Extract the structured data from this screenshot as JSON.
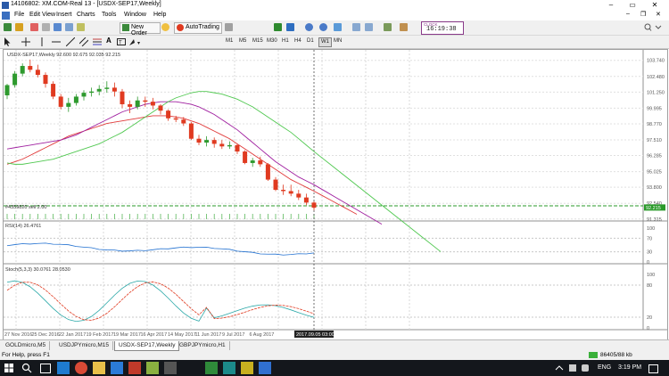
{
  "window": {
    "title": "14106802: XM.COM-Real 13 - [USDX-SEP17,Weekly]",
    "min_glyph": "–",
    "max_glyph": "▭",
    "close_glyph": "✕",
    "child_min_glyph": "–",
    "child_restore_glyph": "❐",
    "child_close_glyph": "✕"
  },
  "menu": {
    "items": [
      "File",
      "Edit",
      "View",
      "Insert",
      "Charts",
      "Tools",
      "Window",
      "Help"
    ]
  },
  "toolbar": {
    "new_order_label": "New Order",
    "autotrading_label": "AutoTrading",
    "clock_label": "CLOCK",
    "clock_time": "16:19:38",
    "timeframes": [
      "M1",
      "M5",
      "M15",
      "M30",
      "H1",
      "H4",
      "D1",
      "W1",
      "MN"
    ],
    "active_timeframe": "W1"
  },
  "chart": {
    "symbol_info": "USDX-SEP17,Weekly  92.600 92.675 92.035 92.215",
    "price_labels": [
      "103.740",
      "102.480",
      "101.250",
      "99.995",
      "98.770",
      "97.510",
      "96.285",
      "95.025",
      "93.800",
      "92.540",
      "92.215",
      "91.315"
    ],
    "current_price": "92.215",
    "order_line_label": "#4359820 sell 2.00",
    "date_labels": [
      "27 Nov 2016",
      "25 Dec 2016",
      "22 Jan 2017",
      "19 Feb 2017",
      "19 Mar 2017",
      "16 Apr 2017",
      "14 May 2017",
      "11 Jun 2017",
      "9 Jul 2017",
      "6 Aug 2017"
    ],
    "crosshair_date": "2017.09.05 03:00",
    "rsi_label": "RSI(14) 26.4761",
    "rsi_levels": [
      "100",
      "70",
      "30",
      "0"
    ],
    "stoch_label": "Stoch(5,3,3) 30.0761 28.0530",
    "stoch_levels": [
      "100",
      "80",
      "20",
      "0"
    ],
    "colors": {
      "bull": "#2e9a2e",
      "bear": "#e03a20",
      "ma_fast": "#e03a3a",
      "ma_mid": "#a020a0",
      "ma_slow": "#50c850",
      "rsi": "#1f6fd0",
      "stoch_main": "#2aa8a8",
      "stoch_signal": "#e03a20"
    }
  },
  "chart_data": {
    "type": "line",
    "title": "USDX-SEP17,Weekly",
    "candles": {
      "x": [
        "2016-11-27",
        "2016-12-04",
        "2016-12-11",
        "2016-12-18",
        "2016-12-25",
        "2017-01-01",
        "2017-01-08",
        "2017-01-15",
        "2017-01-22",
        "2017-01-29",
        "2017-02-05",
        "2017-02-12",
        "2017-02-19",
        "2017-02-26",
        "2017-03-05",
        "2017-03-12",
        "2017-03-19",
        "2017-03-26",
        "2017-04-02",
        "2017-04-09",
        "2017-04-16",
        "2017-04-23",
        "2017-04-30",
        "2017-05-07",
        "2017-05-14",
        "2017-05-21",
        "2017-05-28",
        "2017-06-04",
        "2017-06-11",
        "2017-06-18",
        "2017-06-25",
        "2017-07-02",
        "2017-07-09",
        "2017-07-16",
        "2017-07-23",
        "2017-07-30",
        "2017-08-06",
        "2017-08-13",
        "2017-08-20",
        "2017-08-27",
        "2017-09-03"
      ],
      "open": [
        101.0,
        101.8,
        102.7,
        103.3,
        103.0,
        102.6,
        101.9,
        100.9,
        100.1,
        100.4,
        100.9,
        101.2,
        101.3,
        101.5,
        101.6,
        101.3,
        100.3,
        100.1,
        100.6,
        100.5,
        100.2,
        99.8,
        99.2,
        99.1,
        98.8,
        97.6,
        97.3,
        97.5,
        97.2,
        97.0,
        97.1,
        96.6,
        95.7,
        95.9,
        95.6,
        94.4,
        93.6,
        93.5,
        93.3,
        93.0,
        92.6
      ],
      "high": [
        101.9,
        102.9,
        103.5,
        103.8,
        103.4,
        102.8,
        102.1,
        101.1,
        100.8,
        101.1,
        101.4,
        101.6,
        101.8,
        102.1,
        102.0,
        101.5,
        100.6,
        100.9,
        100.9,
        100.8,
        100.3,
        99.9,
        99.4,
        99.3,
        98.9,
        97.9,
        97.8,
        97.7,
        97.5,
        97.4,
        97.2,
        96.7,
        96.1,
        96.2,
        95.7,
        94.6,
        94.0,
        94.0,
        93.6,
        93.3,
        92.7
      ],
      "low": [
        100.7,
        101.6,
        102.5,
        102.8,
        102.4,
        101.6,
        100.7,
        99.9,
        99.7,
        100.2,
        100.6,
        100.9,
        101.0,
        101.2,
        100.9,
        100.0,
        99.6,
        99.9,
        100.1,
        99.9,
        99.5,
        99.0,
        98.9,
        98.6,
        97.5,
        97.1,
        97.0,
        96.9,
        96.8,
        96.8,
        96.4,
        95.6,
        95.4,
        95.4,
        94.3,
        93.5,
        93.2,
        93.1,
        92.8,
        92.4,
        92.0
      ],
      "close": [
        101.8,
        102.7,
        103.3,
        103.0,
        102.6,
        101.9,
        100.9,
        100.1,
        100.4,
        100.9,
        101.2,
        101.3,
        101.5,
        101.6,
        101.3,
        100.3,
        100.1,
        100.6,
        100.5,
        100.2,
        99.8,
        99.2,
        99.1,
        98.8,
        97.6,
        97.3,
        97.5,
        97.2,
        97.0,
        97.1,
        96.6,
        95.7,
        95.9,
        95.6,
        94.4,
        93.6,
        93.5,
        93.3,
        93.0,
        92.6,
        92.2
      ]
    },
    "series": [
      {
        "values": [
          95.6,
          95.8,
          96.0,
          96.3,
          96.6,
          96.9,
          97.2,
          97.5,
          97.8,
          98.0,
          98.2,
          98.4,
          98.6,
          98.8,
          98.9,
          99.0,
          99.1,
          99.2,
          99.3,
          99.4,
          99.4,
          99.4,
          99.3,
          99.2,
          99.0,
          98.8,
          98.5,
          98.2,
          97.9,
          97.6,
          97.2,
          96.8,
          96.4,
          96.0,
          95.6,
          95.2,
          94.8,
          94.4,
          94.1,
          93.8,
          93.5
        ]
      },
      {
        "values": [
          96.8,
          96.9,
          97.0,
          97.1,
          97.2,
          97.3,
          97.4,
          97.5,
          97.7,
          97.9,
          98.2,
          98.5,
          98.8,
          99.1,
          99.4,
          99.7,
          99.9,
          100.1,
          100.3,
          100.4,
          100.5,
          100.5,
          100.5,
          100.4,
          100.3,
          100.1,
          99.8,
          99.5,
          99.1,
          98.7,
          98.3,
          97.8,
          97.3,
          96.8,
          96.3,
          95.8,
          95.4,
          95.0,
          94.6,
          94.3,
          94.0
        ]
      },
      {
        "values": [
          95.7,
          95.6,
          95.6,
          95.7,
          95.8,
          95.9,
          96.0,
          96.2,
          96.4,
          96.6,
          96.8,
          97.0,
          97.2,
          97.5,
          97.8,
          98.1,
          98.5,
          98.9,
          99.3,
          99.7,
          100.1,
          100.5,
          100.8,
          101.0,
          101.2,
          101.3,
          101.3,
          101.2,
          101.1,
          100.9,
          100.7,
          100.4,
          100.1,
          99.7,
          99.3,
          98.9,
          98.5,
          98.1,
          97.6,
          97.1,
          96.6
        ]
      }
    ],
    "xlabel": "",
    "ylabel": "",
    "ylim": [
      91.3,
      104.0
    ]
  }
}
